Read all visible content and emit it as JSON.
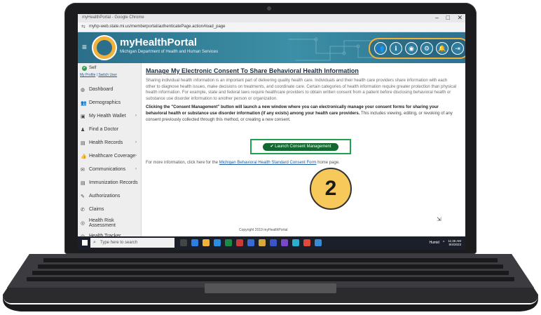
{
  "browser": {
    "window_title": "myHealthPortal - Google Chrome",
    "url": "myhp-web.state.mi.us/memberportal/authenticatePage.action#load_page",
    "win_min": "–",
    "win_max": "□",
    "win_close": "✕"
  },
  "header": {
    "brand": "myHealthPortal",
    "subtitle": "Michigan Department of Health and Human Services",
    "icons": [
      "people-icon",
      "info-icon",
      "globe-icon",
      "settings-icon",
      "bell-icon",
      "logout-icon"
    ],
    "icon_glyphs": [
      "👥",
      "ℹ",
      "◉",
      "⚙",
      "🔔",
      "⇥"
    ],
    "accent": "#f2b13a"
  },
  "sidebar": {
    "self_label": "Self",
    "my_profile": "My Profile",
    "separator": "|",
    "switch_user": "Switch User",
    "items": [
      {
        "label": "Dashboard",
        "glyph": "◍",
        "chevron": ""
      },
      {
        "label": "Demographics",
        "glyph": "👥",
        "chevron": ""
      },
      {
        "label": "My Health Wallet",
        "glyph": "▣",
        "chevron": "›"
      },
      {
        "label": "Find a Doctor",
        "glyph": "♟",
        "chevron": ""
      },
      {
        "label": "Health Records",
        "glyph": "▤",
        "chevron": "›"
      },
      {
        "label": "Healthcare Coverage",
        "glyph": "👍",
        "chevron": "›"
      },
      {
        "label": "Communications",
        "glyph": "✉",
        "chevron": "›"
      },
      {
        "label": "Immunization Records",
        "glyph": "▤",
        "chevron": ""
      },
      {
        "label": "Authorizations",
        "glyph": "✎",
        "chevron": ""
      },
      {
        "label": "Claims",
        "glyph": "✆",
        "chevron": ""
      },
      {
        "label": "Health Risk Assessment",
        "glyph": "◎",
        "chevron": ""
      },
      {
        "label": "Health Tracker",
        "glyph": "◷",
        "chevron": ""
      }
    ]
  },
  "main": {
    "title": "Manage My Electronic Consent To Share Behavioral Health Information",
    "para1": "Sharing individual health information is an important part of delivering quality health care. Individuals and their health care providers share information with each other to diagnose health issues, make decisions on treatments, and coordinate care. Certain categories of health information require greater protection than physical health information. For example, state and federal laws require healthcare providers to obtain written consent from a patient before disclosing behavioral health or substance use disorder information to another person or organization.",
    "para2_bold": "Clicking the \"Consent Management\" button will launch a new window where you can electronically manage your consent forms for sharing your behavioral health or substance use disorder information (if any exists) among your health care providers.",
    "para2_rest": " This includes viewing, editing, or revoking of any consent previously collected through this method, or creating a new consent.",
    "launch_button": "✔ Launch Consent Management",
    "more_prefix": "For more information, click here for the ",
    "more_link": "Michigan Behavioral Health Standard Consent Form",
    "more_suffix": " home page.",
    "step_number": "2",
    "copyright": "Copyright 2019 myHealthPortal"
  },
  "taskbar": {
    "search_placeholder": "Type here to search",
    "weather": "Humid",
    "time": "11:35 AM",
    "date": "8/4/2023"
  }
}
